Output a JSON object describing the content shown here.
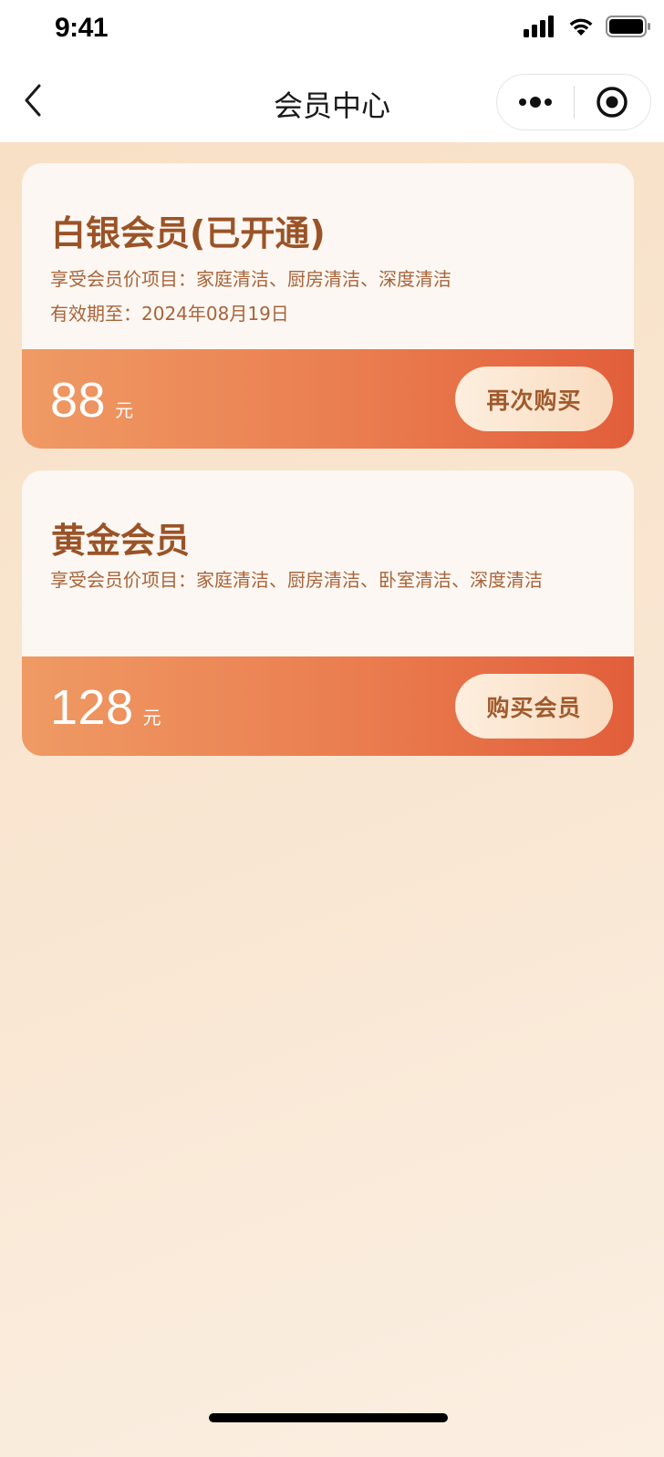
{
  "status_bar": {
    "time": "9:41"
  },
  "nav": {
    "title": "会员中心"
  },
  "memberships": [
    {
      "title": "白银会员(已开通)",
      "benefits": "享受会员价项目：家庭清洁、厨房清洁、深度清洁",
      "validity": "有效期至：2024年08月19日",
      "price": "88",
      "unit": "元",
      "button": "再次购买"
    },
    {
      "title": "黄金会员",
      "benefits": "享受会员价项目：家庭清洁、厨房清洁、卧室清洁、深度清洁",
      "price": "128",
      "unit": "元",
      "button": "购买会员"
    }
  ],
  "colors": {
    "accent_brown": "#9a5327",
    "price_band_start": "#ef9a64",
    "price_band_end": "#e25e3b"
  }
}
